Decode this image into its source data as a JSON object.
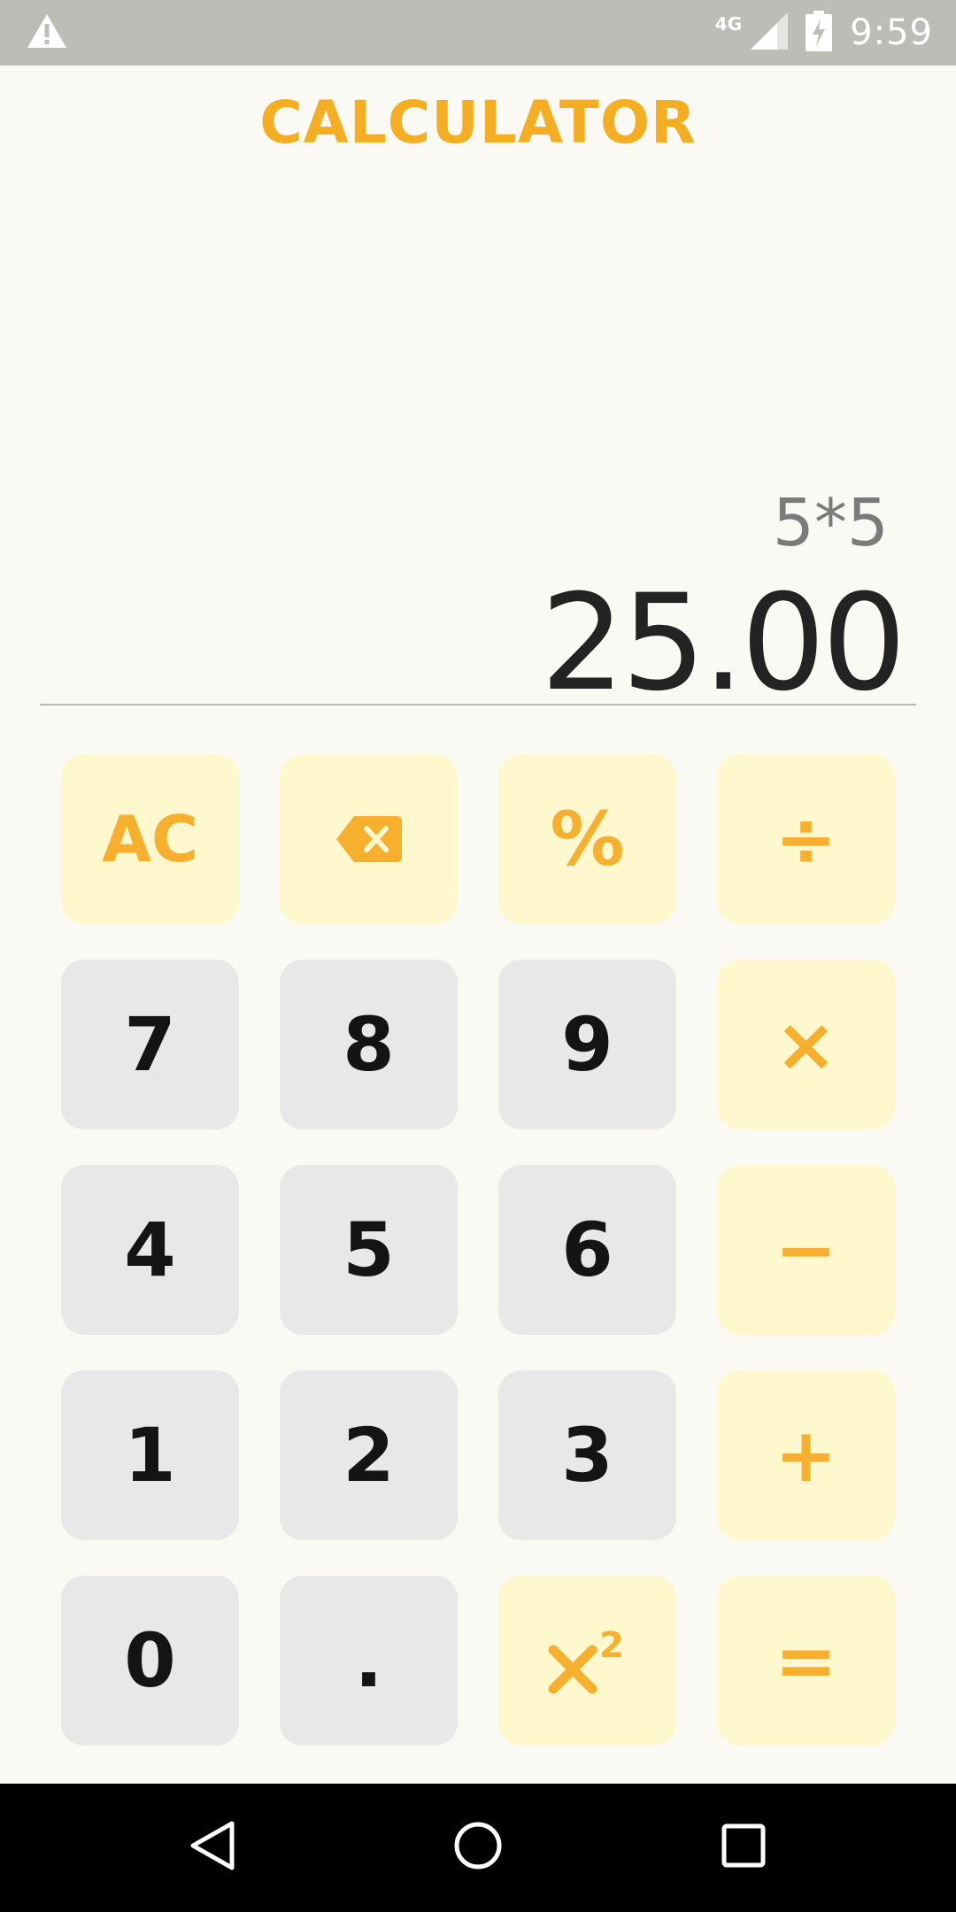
{
  "status_bar": {
    "network_type": "4G",
    "time": "9:59",
    "icons": [
      "warning-icon",
      "signal-icon",
      "battery-charging-icon"
    ],
    "bg_color": "#bdbdb8"
  },
  "app": {
    "title": "CALCULATOR",
    "accent_color": "#f5ae21"
  },
  "display": {
    "expression": "5*5",
    "result": "25.00"
  },
  "keypad": {
    "ac_label": "AC",
    "backspace_icon": "backspace-icon",
    "percent_label": "%",
    "divide_label": "÷",
    "multiply_label": "×",
    "minus_label": "−",
    "plus_label": "+",
    "equals_label": "=",
    "square_icon": "x-squared-icon",
    "digits": {
      "d7": "7",
      "d8": "8",
      "d9": "9",
      "d4": "4",
      "d5": "5",
      "d6": "6",
      "d1": "1",
      "d2": "2",
      "d3": "3",
      "d0": "0",
      "dot": "."
    },
    "number_key_color": "#e8e8e8",
    "operator_key_color": "#fff8cf"
  },
  "nav_bar": {
    "icons": [
      "back-icon",
      "home-icon",
      "recents-icon"
    ]
  }
}
